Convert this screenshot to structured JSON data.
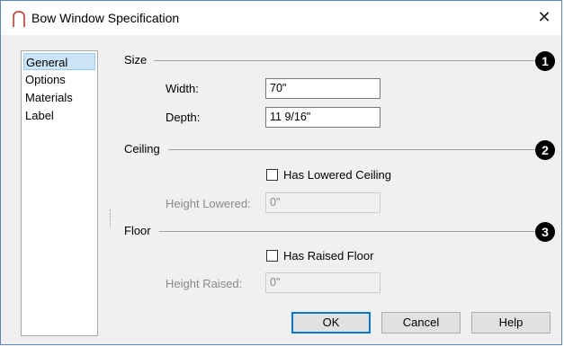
{
  "window": {
    "title": "Bow Window Specification",
    "close_glyph": "✕"
  },
  "nav": {
    "items": [
      {
        "label": "General",
        "selected": true
      },
      {
        "label": "Options"
      },
      {
        "label": "Materials"
      },
      {
        "label": "Label"
      }
    ]
  },
  "size": {
    "heading": "Size",
    "callout": "1",
    "width_label": "Width:",
    "width_value": "70\"",
    "depth_label": "Depth:",
    "depth_value": "11 9/16\""
  },
  "ceiling": {
    "heading": "Ceiling",
    "callout": "2",
    "checkbox_label": "Has Lowered Ceiling",
    "checked": false,
    "height_label": "Height Lowered:",
    "height_value": "0\""
  },
  "floor": {
    "heading": "Floor",
    "callout": "3",
    "checkbox_label": "Has Raised Floor",
    "checked": false,
    "height_label": "Height Raised:",
    "height_value": "0\""
  },
  "buttons": {
    "ok": "OK",
    "cancel": "Cancel",
    "help": "Help"
  },
  "colors": {
    "accent": "#0078d7",
    "selection": "#cce4f7"
  },
  "icons": {
    "title": "bow-window-icon",
    "close": "close-icon"
  }
}
